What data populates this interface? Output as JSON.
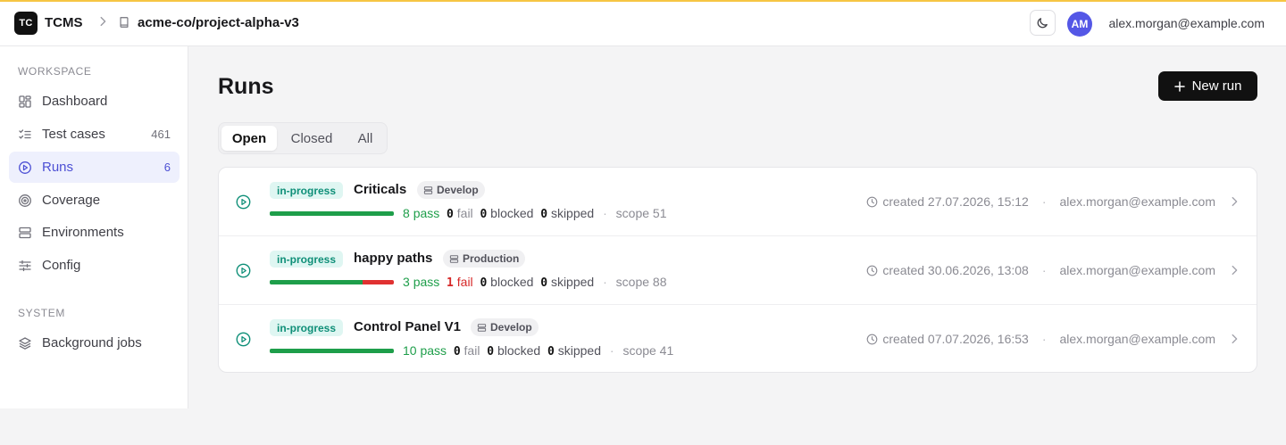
{
  "header": {
    "logo_text": "TC",
    "brand": "TCMS",
    "repo": "acme-co/project-alpha-v3",
    "avatar_initials": "AM",
    "user_email": "alex.morgan@example.com"
  },
  "sidebar": {
    "workspace_label": "WORKSPACE",
    "system_label": "SYSTEM",
    "items": [
      {
        "label": "Dashboard",
        "count": "",
        "icon": "dashboard-icon"
      },
      {
        "label": "Test cases",
        "count": "461",
        "icon": "list-check-icon"
      },
      {
        "label": "Runs",
        "count": "6",
        "icon": "play-circle-icon",
        "active": true
      },
      {
        "label": "Coverage",
        "count": "",
        "icon": "target-icon"
      },
      {
        "label": "Environments",
        "count": "",
        "icon": "server-icon"
      },
      {
        "label": "Config",
        "count": "",
        "icon": "sliders-icon"
      }
    ],
    "system_items": [
      {
        "label": "Background jobs",
        "icon": "layers-icon"
      }
    ]
  },
  "main": {
    "title": "Runs",
    "new_run_label": "New run",
    "tabs": [
      {
        "label": "Open",
        "active": true
      },
      {
        "label": "Closed"
      },
      {
        "label": "All"
      }
    ],
    "runs": [
      {
        "status": "in-progress",
        "name": "Criticals",
        "environment": "Develop",
        "pass": "8",
        "pass_label": "pass",
        "fail": "0",
        "fail_label": "fail",
        "blocked": "0",
        "blocked_label": "blocked",
        "skipped": "0",
        "skipped_label": "skipped",
        "scope": "scope 51",
        "pass_fraction": 1.0,
        "fail_fraction": 0.0,
        "created": "created 27.07.2026, 15:12",
        "author": "alex.morgan@example.com"
      },
      {
        "status": "in-progress",
        "name": "happy paths",
        "environment": "Production",
        "pass": "3",
        "pass_label": "pass",
        "fail": "1",
        "fail_label": "fail",
        "blocked": "0",
        "blocked_label": "blocked",
        "skipped": "0",
        "skipped_label": "skipped",
        "scope": "scope 88",
        "pass_fraction": 0.75,
        "fail_fraction": 0.25,
        "created": "created 30.06.2026, 13:08",
        "author": "alex.morgan@example.com"
      },
      {
        "status": "in-progress",
        "name": "Control Panel V1",
        "environment": "Develop",
        "pass": "10",
        "pass_label": "pass",
        "fail": "0",
        "fail_label": "fail",
        "blocked": "0",
        "blocked_label": "blocked",
        "skipped": "0",
        "skipped_label": "skipped",
        "scope": "scope 41",
        "pass_fraction": 1.0,
        "fail_fraction": 0.0,
        "created": "created 07.07.2026, 16:53",
        "author": "alex.morgan@example.com"
      }
    ]
  },
  "colors": {
    "accent": "#4c4fd4",
    "pass": "#1e9e4a",
    "fail": "#e03131",
    "status_badge": "#0f8f78",
    "top_line": "#f6c544"
  }
}
